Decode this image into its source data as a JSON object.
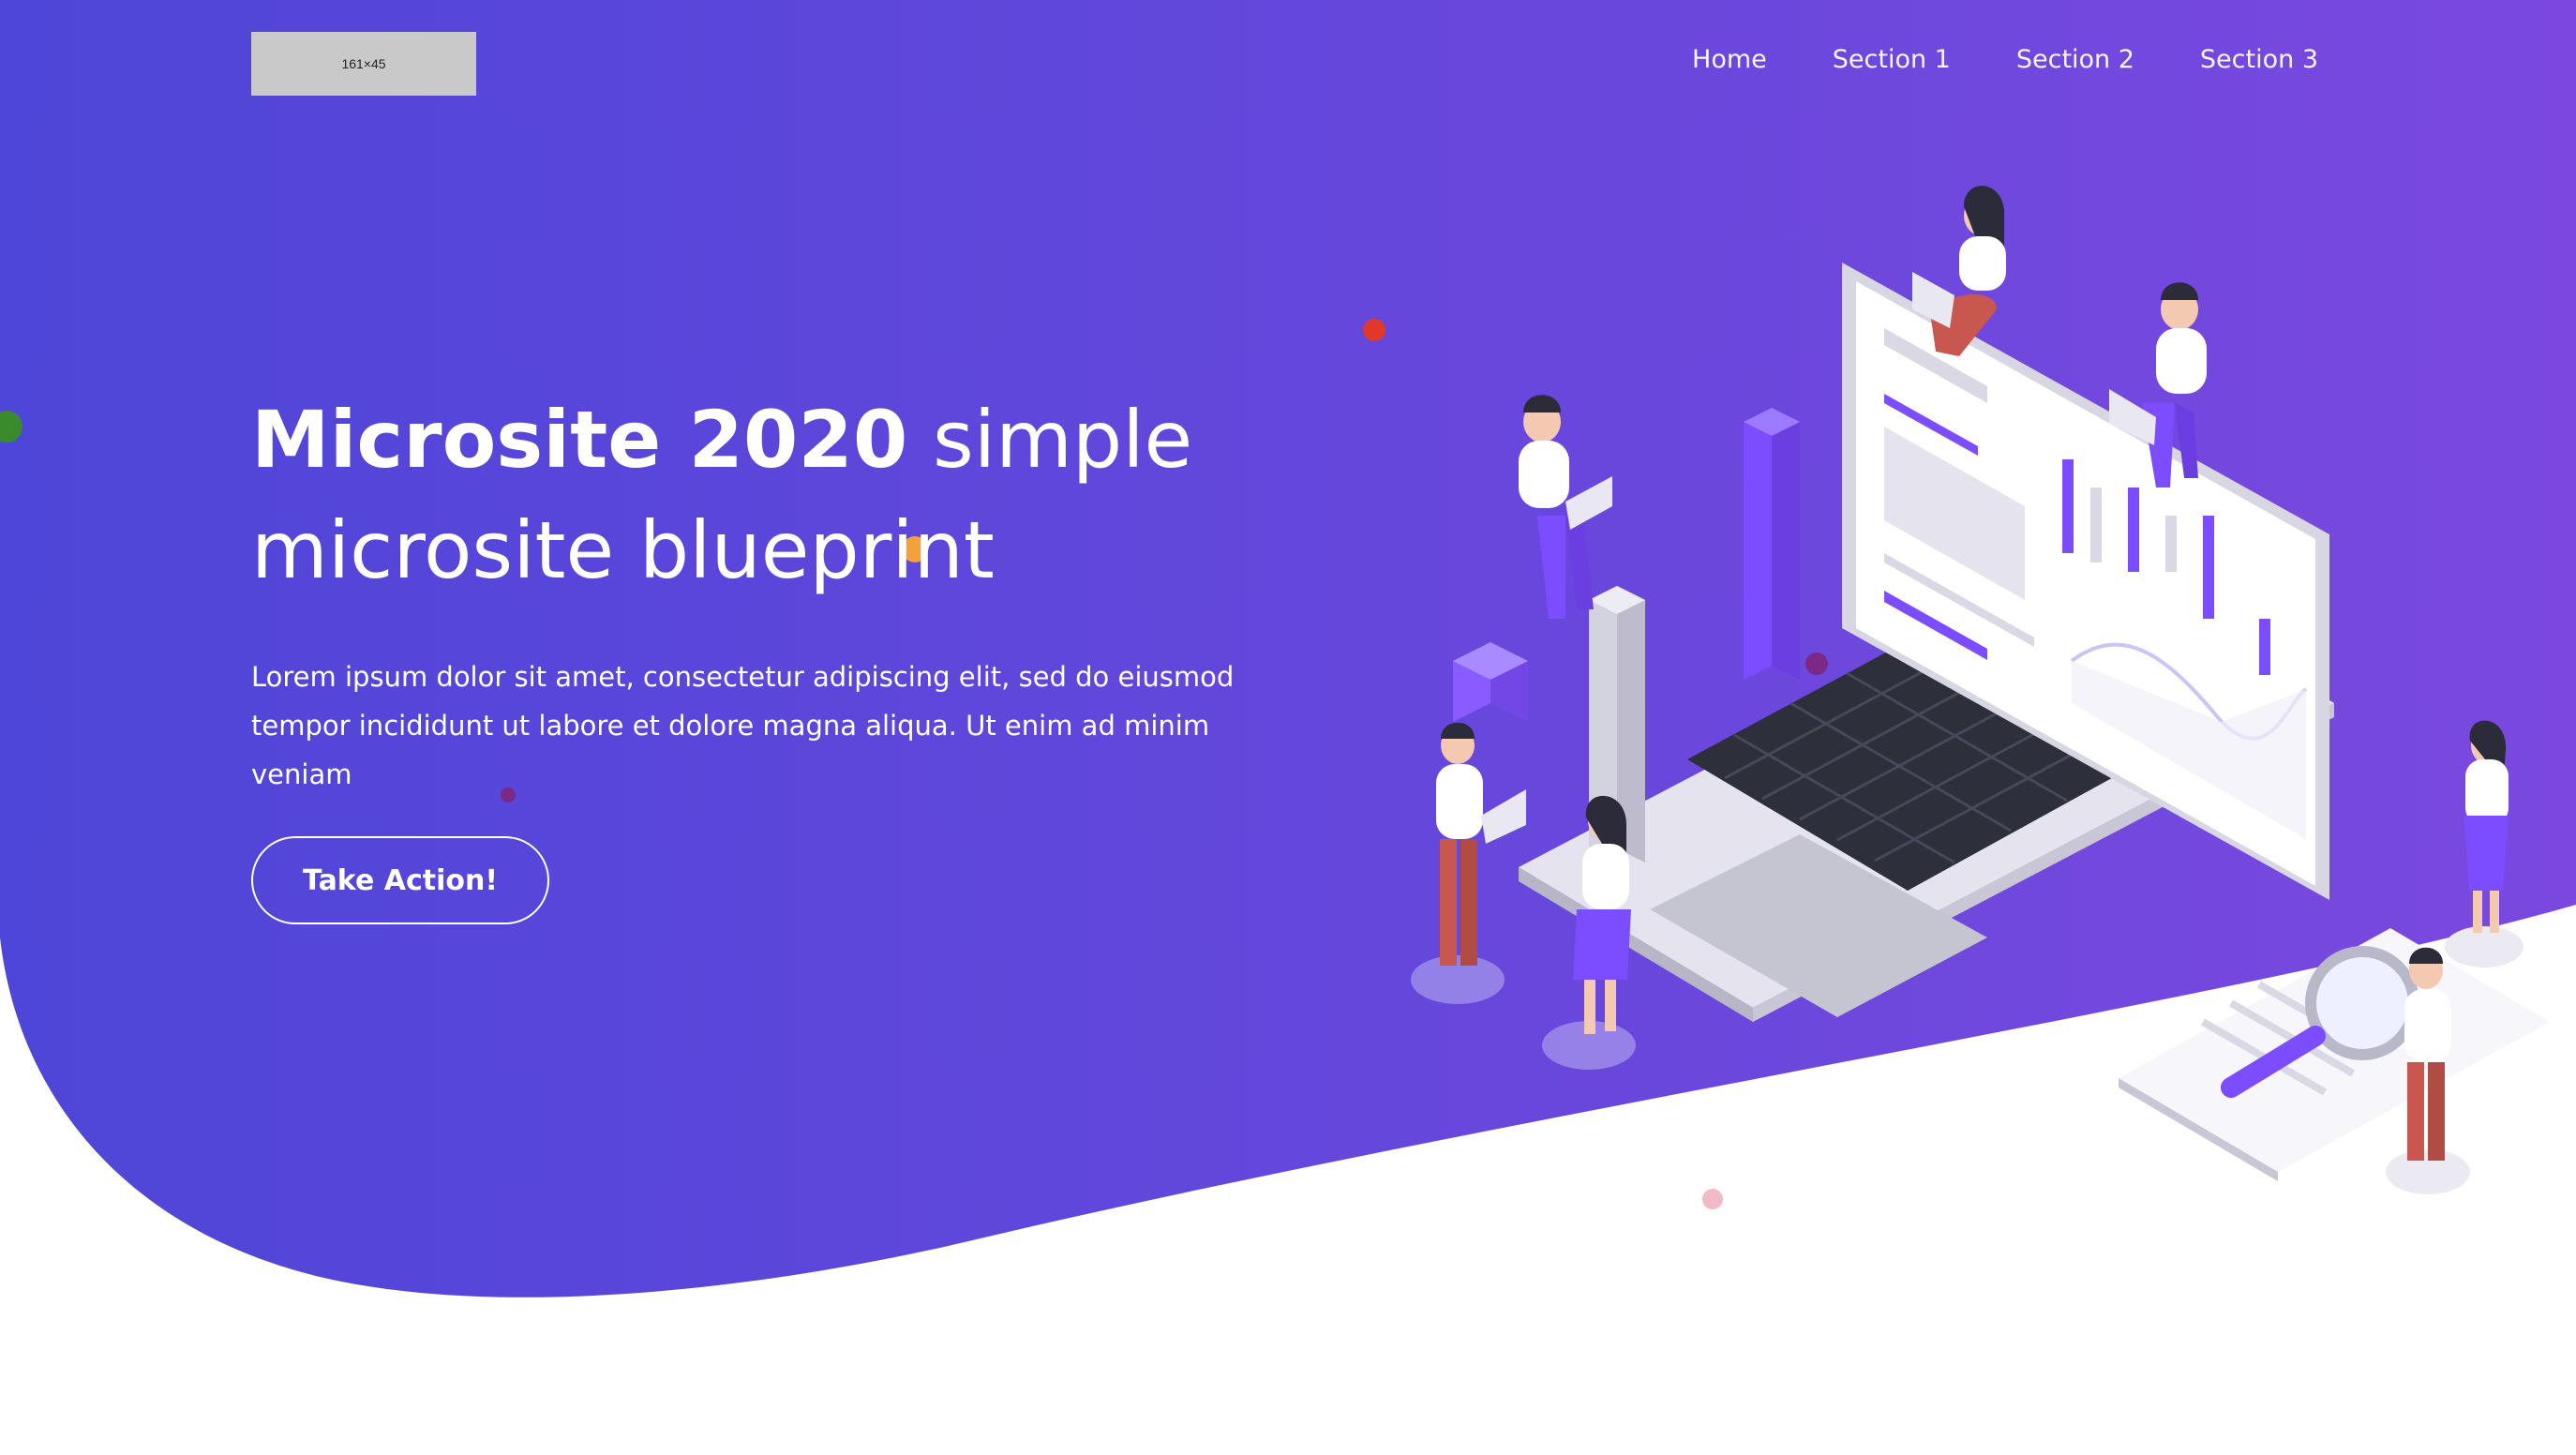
{
  "logo": {
    "placeholder_text": "161×45"
  },
  "nav": {
    "items": [
      {
        "label": "Home"
      },
      {
        "label": "Section 1"
      },
      {
        "label": "Section 2"
      },
      {
        "label": "Section 3"
      }
    ]
  },
  "hero": {
    "title_bold": "Microsite 2020",
    "title_rest": " simple microsite blueprint",
    "description": "Lorem ipsum dolor sit amet, consectetur adipiscing elit, sed do eiusmod tempor incididunt ut labore et dolore magna aliqua. Ut enim ad minim veniam",
    "cta_label": "Take Action!"
  },
  "colors": {
    "gradient_start": "#4e46d8",
    "gradient_end": "#7b4ae0",
    "accent_purple": "#7c4dff",
    "white": "#ffffff"
  }
}
